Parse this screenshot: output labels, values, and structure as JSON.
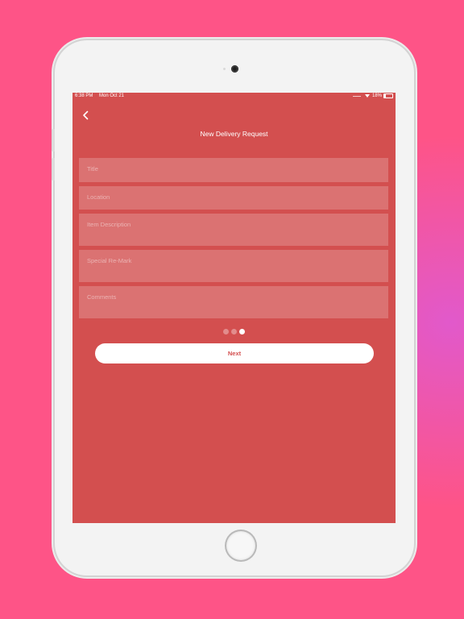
{
  "colors": {
    "background": "#fe5487",
    "screen": "#d34f4f",
    "accent_text": "#d34f4f",
    "device": "#f3f3f3"
  },
  "status_bar": {
    "time": "6:38 PM",
    "date": "Mon Oct 21",
    "battery": "18%",
    "battery_level": 0.18
  },
  "header": {
    "back_icon": "chevron-left-icon",
    "title": "New Delivery Request"
  },
  "form": {
    "fields": [
      {
        "placeholder": "Title",
        "value": ""
      },
      {
        "placeholder": "Location",
        "value": ""
      },
      {
        "placeholder": "Item Description",
        "value": ""
      },
      {
        "placeholder": "Special Re-Mark",
        "value": ""
      },
      {
        "placeholder": "Comments",
        "value": ""
      }
    ]
  },
  "pager": {
    "total": 3,
    "current": 3
  },
  "actions": {
    "next_label": "Next"
  }
}
